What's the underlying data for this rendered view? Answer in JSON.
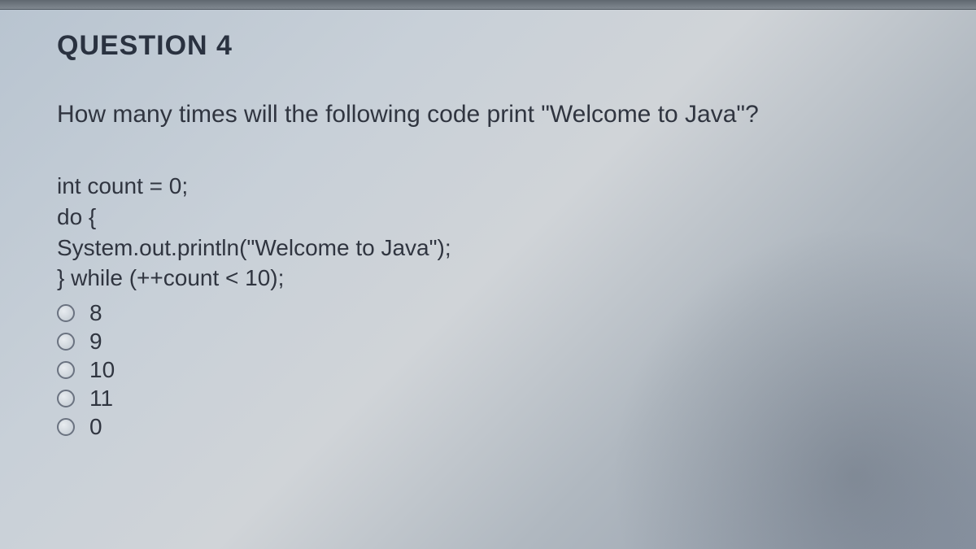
{
  "question": {
    "title": "QUESTION 4",
    "prompt": "How many times will the following code print \"Welcome to Java\"?",
    "code": {
      "line1": "int count = 0;",
      "line2": "do {",
      "line3": "System.out.println(\"Welcome to Java\");",
      "line4": "} while (++count < 10);"
    },
    "options": [
      {
        "label": "8"
      },
      {
        "label": "9"
      },
      {
        "label": "10"
      },
      {
        "label": "11"
      },
      {
        "label": "0"
      }
    ]
  }
}
